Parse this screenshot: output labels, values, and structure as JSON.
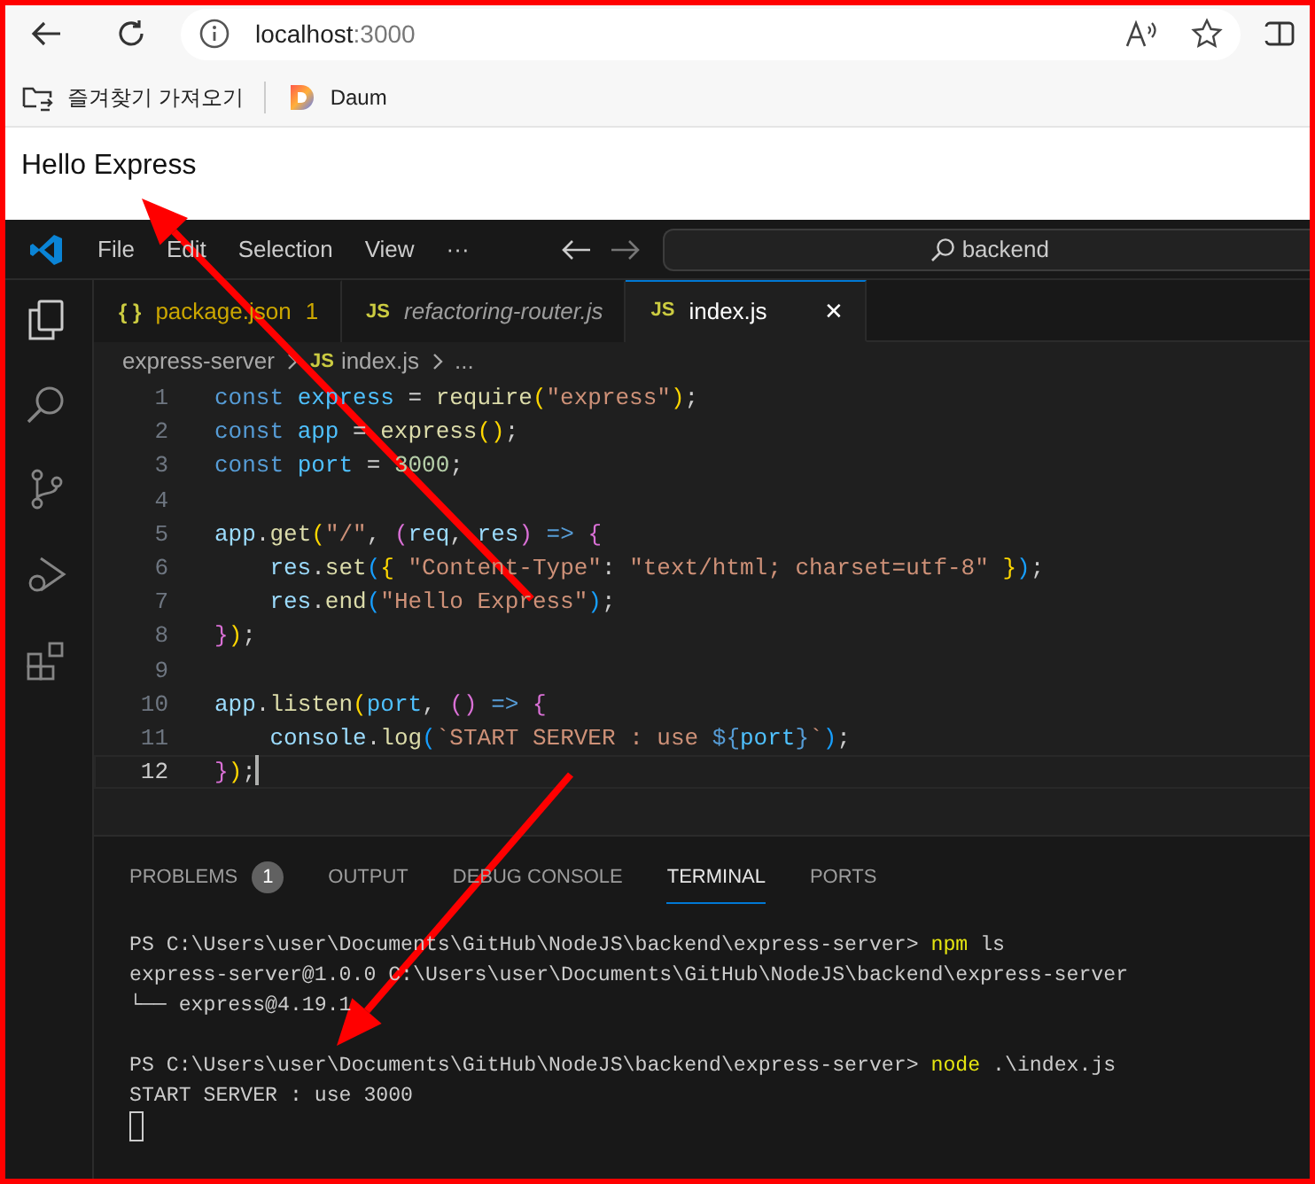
{
  "browser": {
    "address": {
      "host": "localhost",
      "port": ":3000"
    },
    "bookmarks": [
      {
        "kind": "import",
        "label": "즐겨찾기 가져오기"
      },
      {
        "kind": "site",
        "label": "Daum"
      }
    ],
    "page": {
      "text": "Hello Express"
    }
  },
  "editor": {
    "menu": [
      "File",
      "Edit",
      "Selection",
      "View",
      "···"
    ],
    "search": {
      "value": "backend"
    },
    "tabs": [
      {
        "icon": "{ }",
        "label": "package.json",
        "badge": "1",
        "kind": "json",
        "preview": false,
        "selected": false
      },
      {
        "icon": "JS",
        "label": "refactoring-router.js",
        "kind": "js",
        "preview": true,
        "selected": false
      },
      {
        "icon": "JS",
        "label": "index.js",
        "kind": "js",
        "preview": false,
        "selected": true,
        "close": "✕"
      }
    ],
    "breadcrumb": [
      {
        "label": "express-server"
      },
      {
        "icon": "JS",
        "label": "index.js"
      },
      {
        "label": "..."
      }
    ],
    "code": [
      {
        "number": "1",
        "current": false,
        "tokens": [
          {
            "kind": "kw",
            "text": "const "
          },
          {
            "kind": "cv",
            "text": "express"
          },
          {
            "kind": "p",
            "text": " = "
          },
          {
            "kind": "fn",
            "text": "require"
          },
          {
            "kind": "b1",
            "text": "("
          },
          {
            "kind": "str",
            "text": "\"express\""
          },
          {
            "kind": "b1",
            "text": ")"
          },
          {
            "kind": "p",
            "text": ";"
          }
        ]
      },
      {
        "number": "2",
        "current": false,
        "tokens": [
          {
            "kind": "kw",
            "text": "const "
          },
          {
            "kind": "cv",
            "text": "app"
          },
          {
            "kind": "p",
            "text": " = "
          },
          {
            "kind": "fn",
            "text": "express"
          },
          {
            "kind": "b1",
            "text": "()"
          },
          {
            "kind": "p",
            "text": ";"
          }
        ]
      },
      {
        "number": "3",
        "current": false,
        "tokens": [
          {
            "kind": "kw",
            "text": "const "
          },
          {
            "kind": "cv",
            "text": "port"
          },
          {
            "kind": "p",
            "text": " = "
          },
          {
            "kind": "num",
            "text": "3000"
          },
          {
            "kind": "p",
            "text": ";"
          }
        ]
      },
      {
        "number": "4",
        "current": false
      },
      {
        "number": "5",
        "current": false,
        "tokens": [
          {
            "kind": "v",
            "text": "app"
          },
          {
            "kind": "p",
            "text": "."
          },
          {
            "kind": "fn",
            "text": "get"
          },
          {
            "kind": "b1",
            "text": "("
          },
          {
            "kind": "str",
            "text": "\"/\""
          },
          {
            "kind": "p",
            "text": ", "
          },
          {
            "kind": "b2",
            "text": "("
          },
          {
            "kind": "v",
            "text": "req"
          },
          {
            "kind": "p",
            "text": ", "
          },
          {
            "kind": "v",
            "text": "res"
          },
          {
            "kind": "b2",
            "text": ")"
          },
          {
            "kind": "kw",
            "text": " => "
          },
          {
            "kind": "b2",
            "text": "{"
          }
        ]
      },
      {
        "number": "6",
        "current": false,
        "tokens": [
          {
            "kind": "v",
            "text": "    res"
          },
          {
            "kind": "p",
            "text": "."
          },
          {
            "kind": "fn",
            "text": "set"
          },
          {
            "kind": "b3",
            "text": "("
          },
          {
            "kind": "b1",
            "text": "{ "
          },
          {
            "kind": "str",
            "text": "\"Content-Type\""
          },
          {
            "kind": "p",
            "text": ": "
          },
          {
            "kind": "str",
            "text": "\"text/html; charset=utf-8\""
          },
          {
            "kind": "b1",
            "text": " }"
          },
          {
            "kind": "b3",
            "text": ")"
          },
          {
            "kind": "p",
            "text": ";"
          }
        ]
      },
      {
        "number": "7",
        "current": false,
        "tokens": [
          {
            "kind": "v",
            "text": "    res"
          },
          {
            "kind": "p",
            "text": "."
          },
          {
            "kind": "fn",
            "text": "end"
          },
          {
            "kind": "b3",
            "text": "("
          },
          {
            "kind": "str",
            "text": "\"Hello Express\""
          },
          {
            "kind": "b3",
            "text": ")"
          },
          {
            "kind": "p",
            "text": ";"
          }
        ]
      },
      {
        "number": "8",
        "current": false,
        "tokens": [
          {
            "kind": "b2",
            "text": "}"
          },
          {
            "kind": "b1",
            "text": ")"
          },
          {
            "kind": "p",
            "text": ";"
          }
        ]
      },
      {
        "number": "9",
        "current": false
      },
      {
        "number": "10",
        "current": false,
        "tokens": [
          {
            "kind": "v",
            "text": "app"
          },
          {
            "kind": "p",
            "text": "."
          },
          {
            "kind": "fn",
            "text": "listen"
          },
          {
            "kind": "b1",
            "text": "("
          },
          {
            "kind": "cv",
            "text": "port"
          },
          {
            "kind": "p",
            "text": ", "
          },
          {
            "kind": "b2",
            "text": "()"
          },
          {
            "kind": "kw",
            "text": " => "
          },
          {
            "kind": "b2",
            "text": "{"
          }
        ]
      },
      {
        "number": "11",
        "current": false,
        "tokens": [
          {
            "kind": "v",
            "text": "    console"
          },
          {
            "kind": "p",
            "text": "."
          },
          {
            "kind": "fn",
            "text": "log"
          },
          {
            "kind": "b3",
            "text": "("
          },
          {
            "kind": "str",
            "text": "`START SERVER : use "
          },
          {
            "kind": "kw",
            "text": "${"
          },
          {
            "kind": "cv",
            "text": "port"
          },
          {
            "kind": "kw",
            "text": "}"
          },
          {
            "kind": "str",
            "text": "`"
          },
          {
            "kind": "b3",
            "text": ")"
          },
          {
            "kind": "p",
            "text": ";"
          }
        ]
      },
      {
        "number": "12",
        "current": true,
        "tokens": [
          {
            "kind": "b2",
            "text": "}"
          },
          {
            "kind": "b1",
            "text": ")"
          },
          {
            "kind": "p",
            "text": ";"
          }
        ]
      }
    ],
    "panel_tabs": [
      {
        "label": "PROBLEMS",
        "badge": "1",
        "selected": false
      },
      {
        "label": "OUTPUT",
        "selected": false
      },
      {
        "label": "DEBUG CONSOLE",
        "selected": false
      },
      {
        "label": "TERMINAL",
        "selected": true
      },
      {
        "label": "PORTS",
        "selected": false
      }
    ],
    "terminal": {
      "cursor": true,
      "blocks": [
        [
          [
            {
              "kind": "plain",
              "text": "PS C:\\Users\\user\\Documents\\GitHub\\NodeJS\\backend\\express-server> "
            },
            {
              "kind": "cmd",
              "text": "npm"
            },
            {
              "kind": "plain",
              "text": " ls"
            }
          ],
          [
            {
              "kind": "plain",
              "text": "express-server@1.0.0 C:\\Users\\user\\Documents\\GitHub\\NodeJS\\backend\\express-server"
            }
          ],
          [
            {
              "kind": "plain",
              "text": "└── express@4.19.1"
            }
          ]
        ],
        [
          [
            {
              "kind": "plain",
              "text": "PS C:\\Users\\user\\Documents\\GitHub\\NodeJS\\backend\\express-server> "
            },
            {
              "kind": "cmd",
              "text": "node"
            },
            {
              "kind": "plain",
              "text": " .\\index.js"
            }
          ],
          [
            {
              "kind": "plain",
              "text": "START SERVER : use 3000"
            }
          ]
        ]
      ]
    }
  },
  "annotations": [
    {
      "kind": "frame"
    },
    {
      "kind": "arrow"
    },
    {
      "kind": "arrow"
    }
  ]
}
